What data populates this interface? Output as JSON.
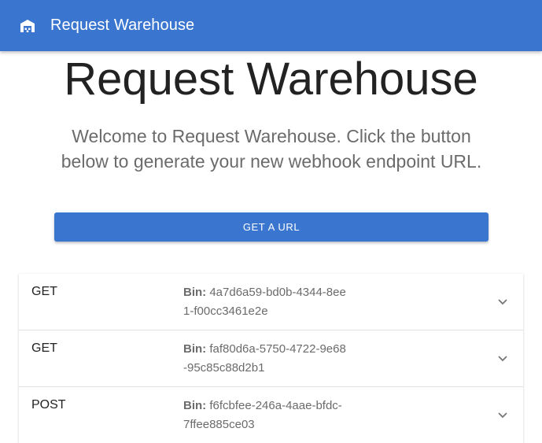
{
  "appbar": {
    "title": "Request Warehouse",
    "icon": "warehouse-icon"
  },
  "hero": {
    "title": "Request Warehouse",
    "text": "Welcome to Request Warehouse. Click the button below to generate your new webhook endpoint URL."
  },
  "actions": {
    "get_url_label": "GET A URL"
  },
  "bins": [
    {
      "method": "GET",
      "label": "Bin:",
      "id": "4a7d6a59-bd0b-4344-8ee1-f00cc3461e2e"
    },
    {
      "method": "GET",
      "label": "Bin:",
      "id": "faf80d6a-5750-4722-9e68-95c85c88d2b1"
    },
    {
      "method": "POST",
      "label": "Bin:",
      "id": "f6fcbfee-246a-4aae-bfdc-7ffee885ce03"
    }
  ],
  "colors": {
    "primary": "#3a76d0",
    "text_muted": "#6b6b6b"
  }
}
